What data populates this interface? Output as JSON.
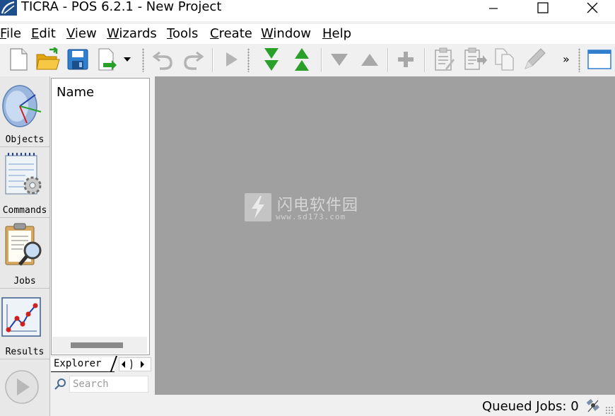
{
  "window": {
    "title": "TICRA - POS 6.2.1 - New Project",
    "accent": "#1e4e8c"
  },
  "menu": {
    "items": [
      "File",
      "Edit",
      "View",
      "Wizards",
      "Tools",
      "Create",
      "Window",
      "Help"
    ]
  },
  "toolbar": {
    "icons": [
      "new-document-icon",
      "open-folder-icon",
      "save-icon",
      "export-icon",
      "undo-icon",
      "redo-icon",
      "run-icon",
      "move-to-bottom-icon",
      "move-to-top-icon",
      "move-down-icon",
      "move-up-icon",
      "add-icon",
      "clipboard-edit-icon",
      "clipboard-paste-icon",
      "copy-icon",
      "pencil-icon",
      "window-icon"
    ],
    "overflow_label": "»",
    "accent_green": "#2aa02a"
  },
  "sidebar": {
    "items": [
      {
        "label": "Objects",
        "icon": "antenna-dish-icon"
      },
      {
        "label": "Commands",
        "icon": "notepad-gear-icon"
      },
      {
        "label": "Jobs",
        "icon": "clipboard-search-icon"
      },
      {
        "label": "Results",
        "icon": "line-chart-icon"
      }
    ]
  },
  "explorer": {
    "header": "Name",
    "tab_label": "Explorer",
    "search_placeholder": "Search"
  },
  "workspace": {
    "background": "#a0a0a0",
    "watermark_title": "闪电软件园",
    "watermark_url": "www.sd173.com"
  },
  "status": {
    "queued_jobs_text": "Queued Jobs:  0"
  }
}
